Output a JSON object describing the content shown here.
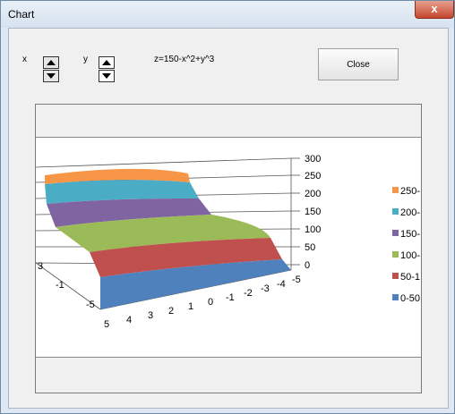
{
  "window": {
    "title": "Chart",
    "close_glyph": "x"
  },
  "controls": {
    "x_label": "x",
    "y_label": "y",
    "formula": "z=150-x^2+y^3",
    "close_label": "Close"
  },
  "chart_data": {
    "type": "surface",
    "formula": "z=150-x^2+y^3",
    "x_ticks": [
      "5",
      "4",
      "3",
      "2",
      "1",
      "0",
      "-1",
      "-2",
      "-3",
      "-4",
      "-5"
    ],
    "y_ticks": [
      "3",
      "-1",
      "-5"
    ],
    "z_ticks": [
      "300",
      "250",
      "200",
      "150",
      "100",
      "50",
      "0"
    ],
    "zlim": [
      0,
      300
    ],
    "legend": [
      "250-",
      "200-",
      "150-",
      "100-",
      "50-1",
      "0-50"
    ],
    "band_colors": [
      "#f79646",
      "#4bacc6",
      "#8064a2",
      "#9bbb59",
      "#c0504d",
      "#4f81bd"
    ],
    "legend_placement": "right"
  }
}
